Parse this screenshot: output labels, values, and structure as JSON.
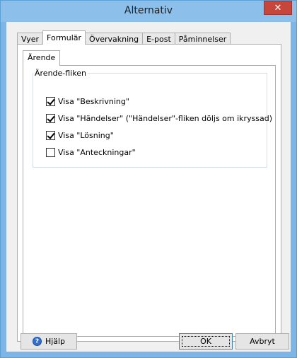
{
  "window": {
    "title": "Alternativ",
    "close_glyph": "✕"
  },
  "tabs": [
    {
      "label": "Vyer",
      "active": false
    },
    {
      "label": "Formulär",
      "active": true
    },
    {
      "label": "Övervakning",
      "active": false
    },
    {
      "label": "E-post",
      "active": false
    },
    {
      "label": "Påminnelser",
      "active": false
    }
  ],
  "inner_tabs": [
    {
      "label": "Ärende",
      "active": true
    }
  ],
  "group": {
    "legend": "Ärende-fliken",
    "options": [
      {
        "label": "Visa \"Beskrivning\"",
        "checked": true
      },
      {
        "label": "Visa \"Händelser\" (\"Händelser\"-fliken döljs om ikryssad)",
        "checked": true
      },
      {
        "label": "Visa \"Lösning\"",
        "checked": true
      },
      {
        "label": "Visa \"Anteckningar\"",
        "checked": false
      }
    ]
  },
  "buttons": {
    "help_label": "Hjälp",
    "ok_label": "OK",
    "cancel_label": "Avbryt"
  }
}
